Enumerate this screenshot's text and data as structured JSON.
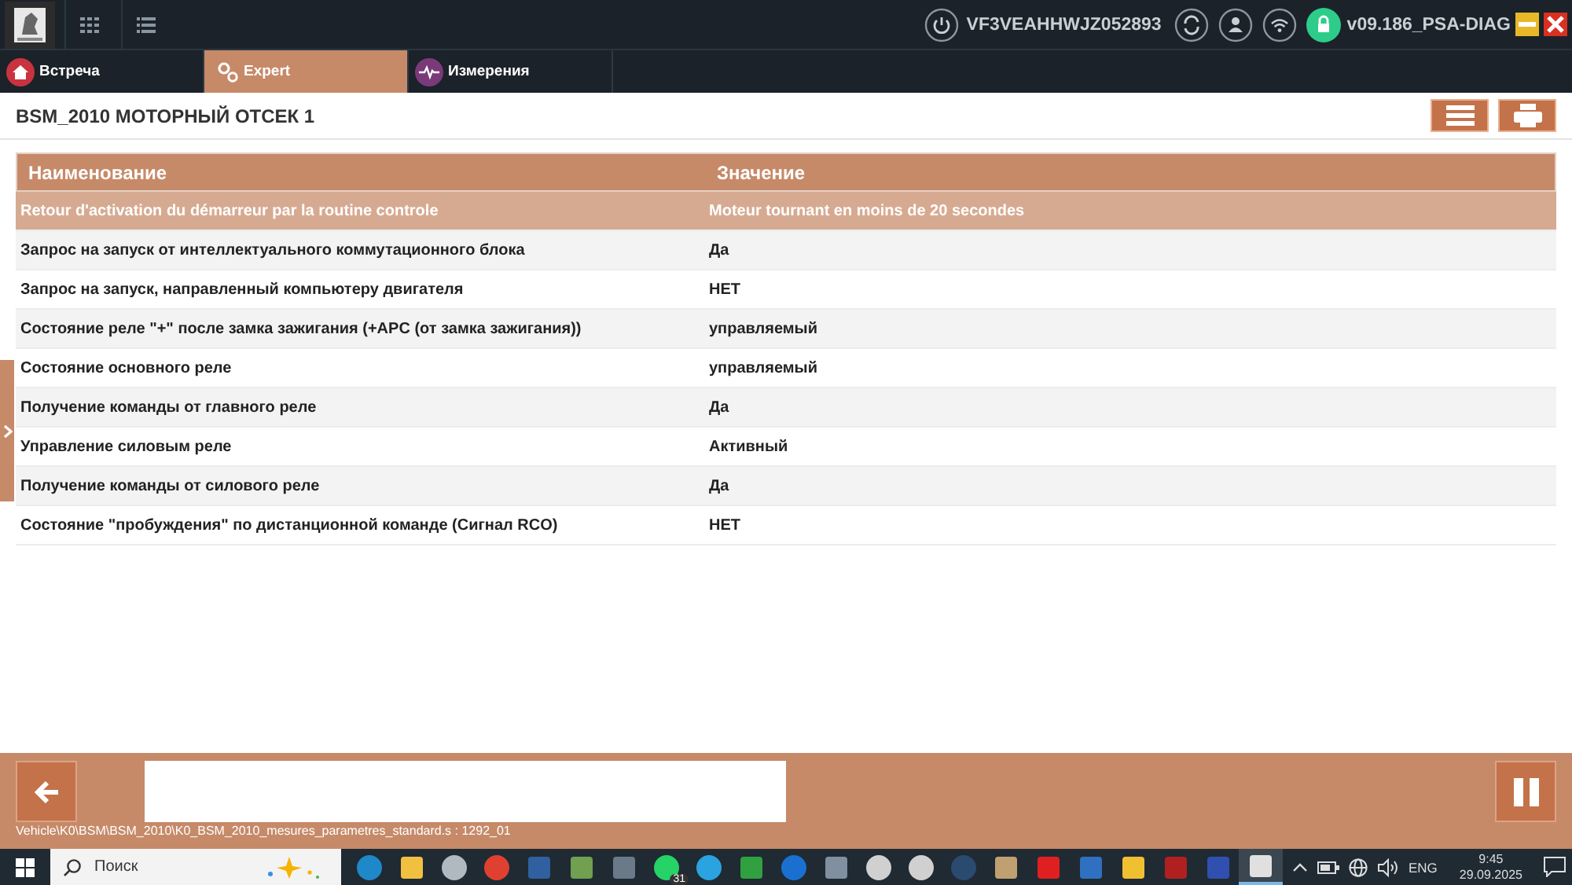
{
  "top_bar": {
    "vin": "VF3VEAHHWJZ052893",
    "version": "v09.186_PSA-DIAG",
    "locked": true
  },
  "tabs": [
    {
      "label": "Встреча",
      "kind": "home",
      "selected": false
    },
    {
      "label": "Expert",
      "kind": "gears",
      "selected": true
    },
    {
      "label": "Измерения",
      "kind": "wave",
      "selected": false
    }
  ],
  "page_title": "BSM_2010 МОТОРНЫЙ ОТСЕК 1",
  "table": {
    "columns": [
      "Наименование",
      "Значение"
    ],
    "rows": [
      {
        "name": "Retour d'activation du démarreur par la routine controle",
        "value": "Moteur tournant en moins de 20 secondes",
        "selected": true
      },
      {
        "name": "Запрос на запуск от интеллектуального коммутационного блока",
        "value": "Да",
        "selected": false
      },
      {
        "name": "Запрос на запуск, направленный компьютеру двигателя",
        "value": "НЕТ",
        "selected": false
      },
      {
        "name": "Состояние реле \"+\" после замка зажигания (+APC (от замка зажигания))",
        "value": "управляемый",
        "selected": false
      },
      {
        "name": "Состояние основного реле",
        "value": "управляемый",
        "selected": false
      },
      {
        "name": "Получение команды от главного реле",
        "value": "Да",
        "selected": false
      },
      {
        "name": "Управление силовым реле",
        "value": "Активный",
        "selected": false
      },
      {
        "name": "Получение команды от силового реле",
        "value": "Да",
        "selected": false
      },
      {
        "name": "Состояние \"пробуждения\" по дистанционной команде (Сигнал RCO)",
        "value": "НЕТ",
        "selected": false
      }
    ]
  },
  "path": "Vehicle\\K0\\BSM\\BSM_2010\\K0_BSM_2010_mesures_parametres_standard.s : 1292_01",
  "taskbar": {
    "search_placeholder": "Поиск",
    "whatsapp_badge": "31",
    "language": "ENG",
    "time": "9:45",
    "date": "29.09.2025"
  }
}
